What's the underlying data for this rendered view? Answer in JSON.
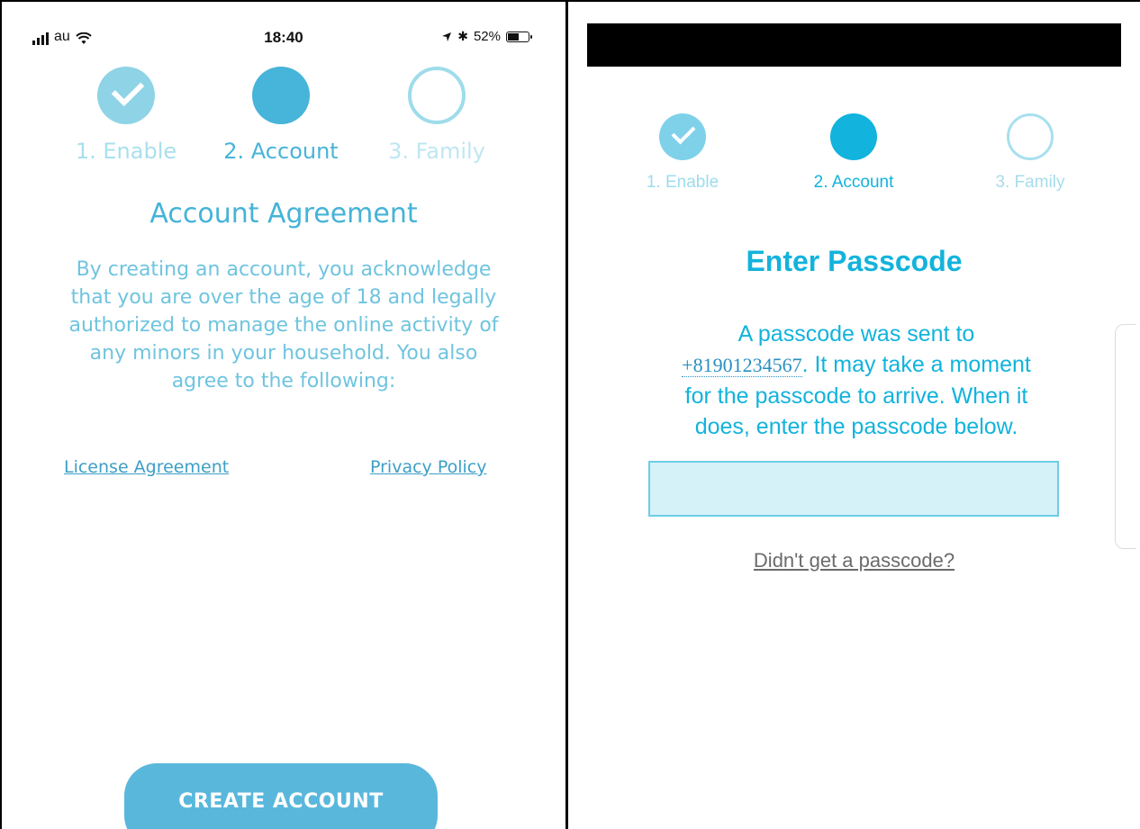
{
  "left": {
    "status": {
      "carrier": "au",
      "time": "18:40",
      "battery": "52%"
    },
    "steps": [
      {
        "label": "1. Enable",
        "state": "done"
      },
      {
        "label": "2. Account",
        "state": "current"
      },
      {
        "label": "3. Family",
        "state": "todo"
      }
    ],
    "title": "Account Agreement",
    "paragraph": "By creating an account, you acknowledge that you are over the age of 18 and legally authorized to manage the online activity of any minors in your household. You also agree to the following:",
    "license_link": "License Agreement",
    "privacy_link": "Privacy Policy",
    "create_button": "CREATE ACCOUNT"
  },
  "right": {
    "steps": [
      {
        "label": "1. Enable",
        "state": "done"
      },
      {
        "label": "2. Account",
        "state": "current"
      },
      {
        "label": "3. Family",
        "state": "todo"
      }
    ],
    "title": "Enter Passcode",
    "msg_line1": "A passcode was sent to",
    "phone": "+81901234567",
    "msg_rest_line2": ". It may take a moment",
    "msg_line3": "for the passcode to arrive. When it",
    "msg_line4": "does, enter the passcode below.",
    "passcode_value": "",
    "resend_link": "Didn't get a passcode?"
  },
  "colors": {
    "left_accent": "#47b4d9",
    "left_step_done": "#8fd3e7",
    "right_accent": "#12b3dc",
    "input_fill": "#d6f2f9",
    "redaction_bar": "#000000"
  }
}
